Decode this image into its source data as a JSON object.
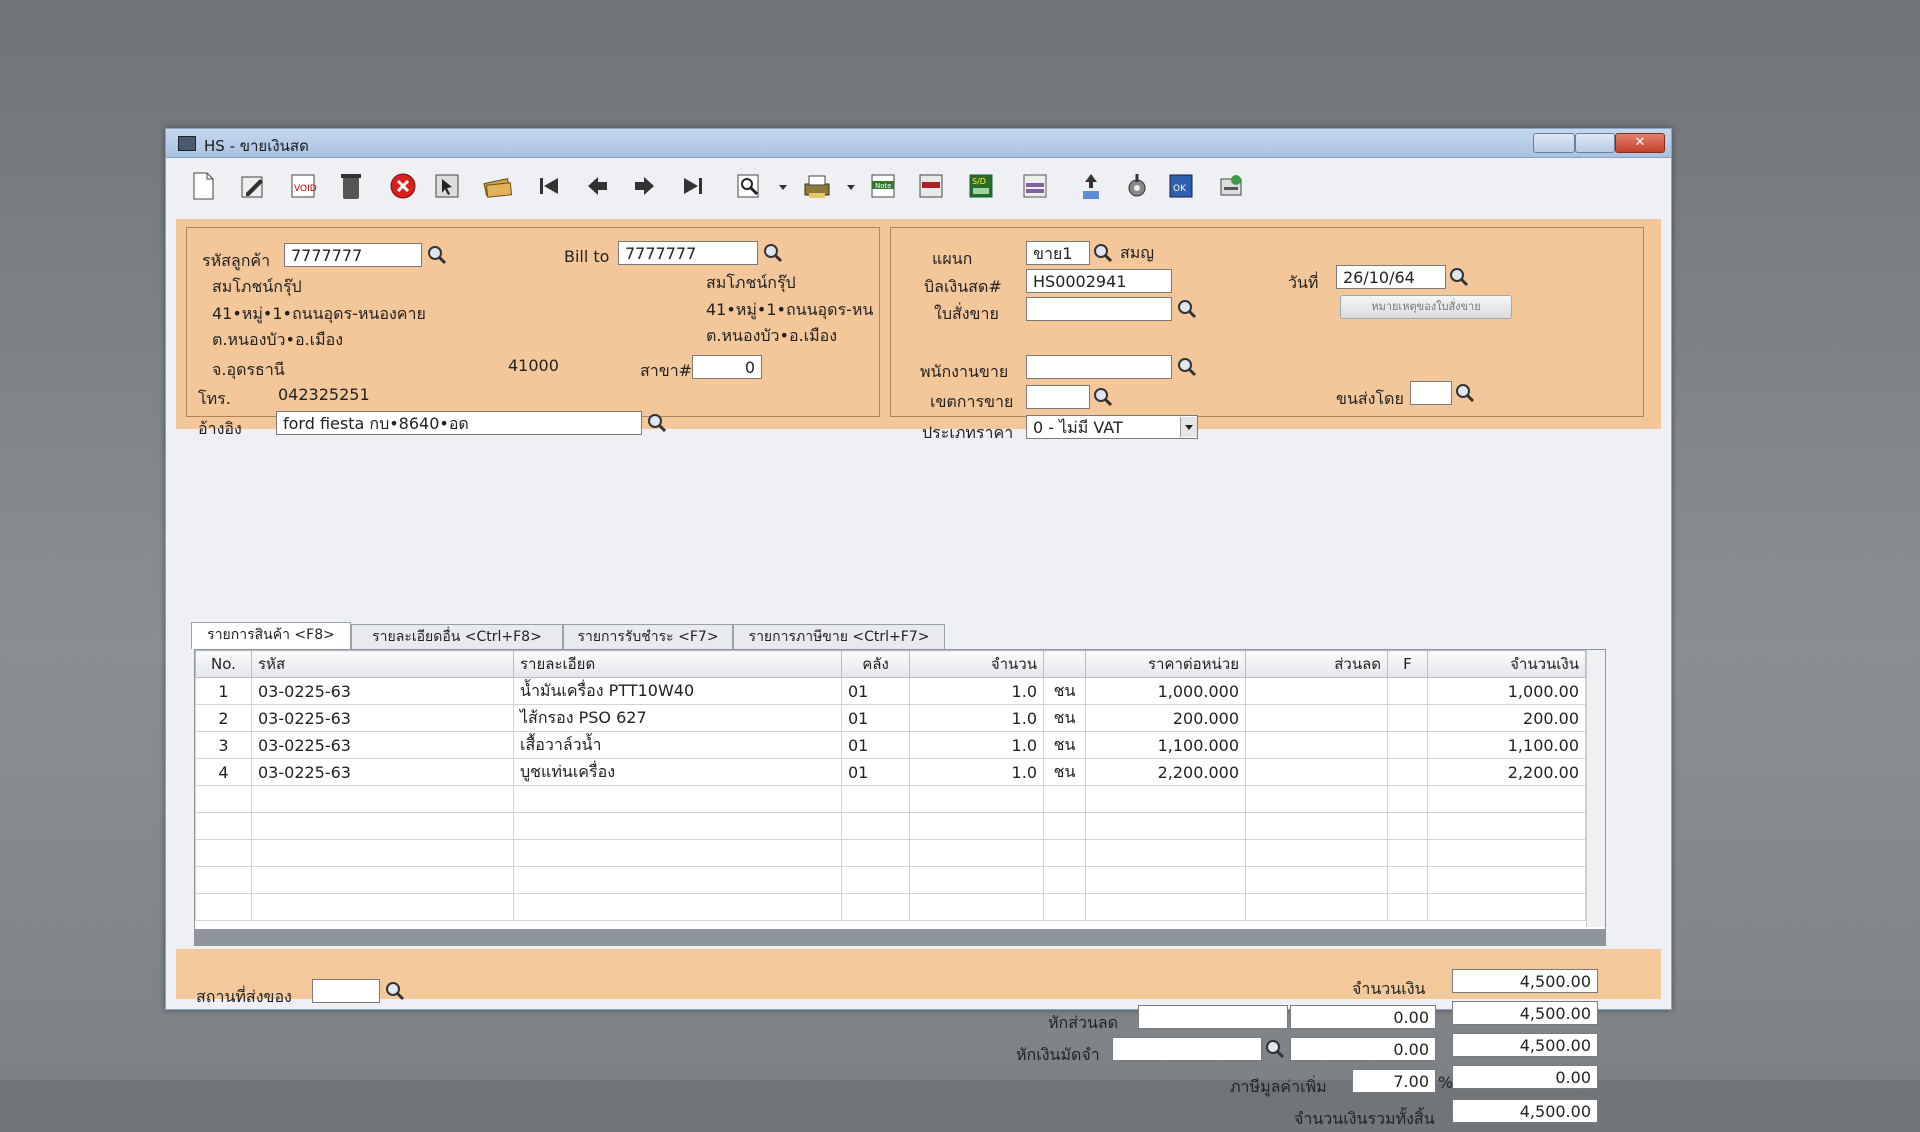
{
  "window": {
    "title": "HS - ขายเงินสด",
    "close_glyph": "✕"
  },
  "toolbar": {
    "icons": [
      "new-doc-icon",
      "edit-icon",
      "void-icon",
      "delete-icon",
      "cancel-icon",
      "select-icon",
      "money-icon",
      "first-icon",
      "prev-icon",
      "next-icon",
      "last-icon",
      "find-icon",
      "print-icon",
      "note-icon",
      "calc-icon",
      "sd-icon",
      "form-icon",
      "upload-ok-icon",
      "tools-icon",
      "ok-icon",
      "print-mail-icon"
    ],
    "note_label": "Note",
    "sd_label": "S/D"
  },
  "customer": {
    "code_label": "รหัสลูกค้า",
    "code": "7777777",
    "billto_label": "Bill to",
    "billto": "7777777",
    "name": "สมโภชน์กรุ๊ป",
    "addr1": "41•หมู่•1•ถนนอุดร-หนองคาย",
    "addr2": "ต.หนองบัว•อ.เมือง",
    "addr3": "จ.อุดรธานี",
    "zip": "41000",
    "bill_name": "สมโภชน์กรุ๊ป",
    "bill_addr1": "41•หมู่•1•ถนนอุดร-หน",
    "bill_addr2": "ต.หนองบัว•อ.เมือง",
    "branch_label": "สาขา#",
    "branch": "0",
    "tel_label": "โทร.",
    "tel": "042325251",
    "ref_label": "อ้างอิง",
    "ref": "ford fiesta กบ•8640•อด"
  },
  "doc": {
    "dept_label": "แผนก",
    "dept": "ขาย1",
    "dept_name": "สมญ",
    "bill_label": "บิลเงินสด#",
    "bill": "HS0002941",
    "order_label": "ใบสั่งขาย",
    "order": "",
    "date_label": "วันที่",
    "date": "26/10/64",
    "note_btn": "หมายเหตุของใบสั่งขาย",
    "salesman_label": "พนักงานขาย",
    "salesman": "",
    "area_label": "เขตการขาย",
    "area": "",
    "ship_label": "ขนส่งโดย",
    "ship": "",
    "pricetype_label": "ประเภทราคา",
    "pricetype": "0 - ไม่มี VAT"
  },
  "tabs": [
    "รายการสินค้า <F8>",
    "รายละเอียดอื่น <Ctrl+F8>",
    "รายการรับชำระ <F7>",
    "รายการภาษีขาย <Ctrl+F7>"
  ],
  "grid": {
    "headers": [
      "No.",
      "รหัส",
      "รายละเอียด",
      "คลัง",
      "จำนวน",
      "",
      "ราคาต่อหน่วย",
      "ส่วนลด",
      "F",
      "จำนวนเงิน"
    ],
    "rows": [
      [
        "1",
        "03-0225-63",
        "น้ำมันเครื่อง PTT10W40",
        "01",
        "1.0",
        "ชน",
        "1,000.000",
        "",
        "",
        "1,000.00"
      ],
      [
        "2",
        "03-0225-63",
        "ไส้กรอง PSO 627",
        "01",
        "1.0",
        "ชน",
        "200.000",
        "",
        "",
        "200.00"
      ],
      [
        "3",
        "03-0225-63",
        "เสื้อวาล์วน้ำ",
        "01",
        "1.0",
        "ชน",
        "1,100.000",
        "",
        "",
        "1,100.00"
      ],
      [
        "4",
        "03-0225-63",
        "บูชแท่นเครื่อง",
        "01",
        "1.0",
        "ชน",
        "2,200.000",
        "",
        "",
        "2,200.00"
      ]
    ]
  },
  "footer": {
    "delivery_label": "สถานที่ส่งของ",
    "delivery": "",
    "amount_label": "จำนวนเงิน",
    "amount": "4,500.00",
    "discount_label": "หักส่วนลด",
    "discount": "",
    "discount_amt": "0.00",
    "after_discount": "4,500.00",
    "deposit_label": "หักเงินมัดจำ",
    "deposit": "",
    "deposit_amt": "0.00",
    "after_deposit": "4,500.00",
    "vat_label": "ภาษีมูลค่าเพิ่ม",
    "vat_rate": "7.00",
    "vat_pct": "%",
    "vat_amt": "0.00",
    "total_label": "จำนวนเงินรวมทั้งสิ้น",
    "total": "4,500.00"
  }
}
